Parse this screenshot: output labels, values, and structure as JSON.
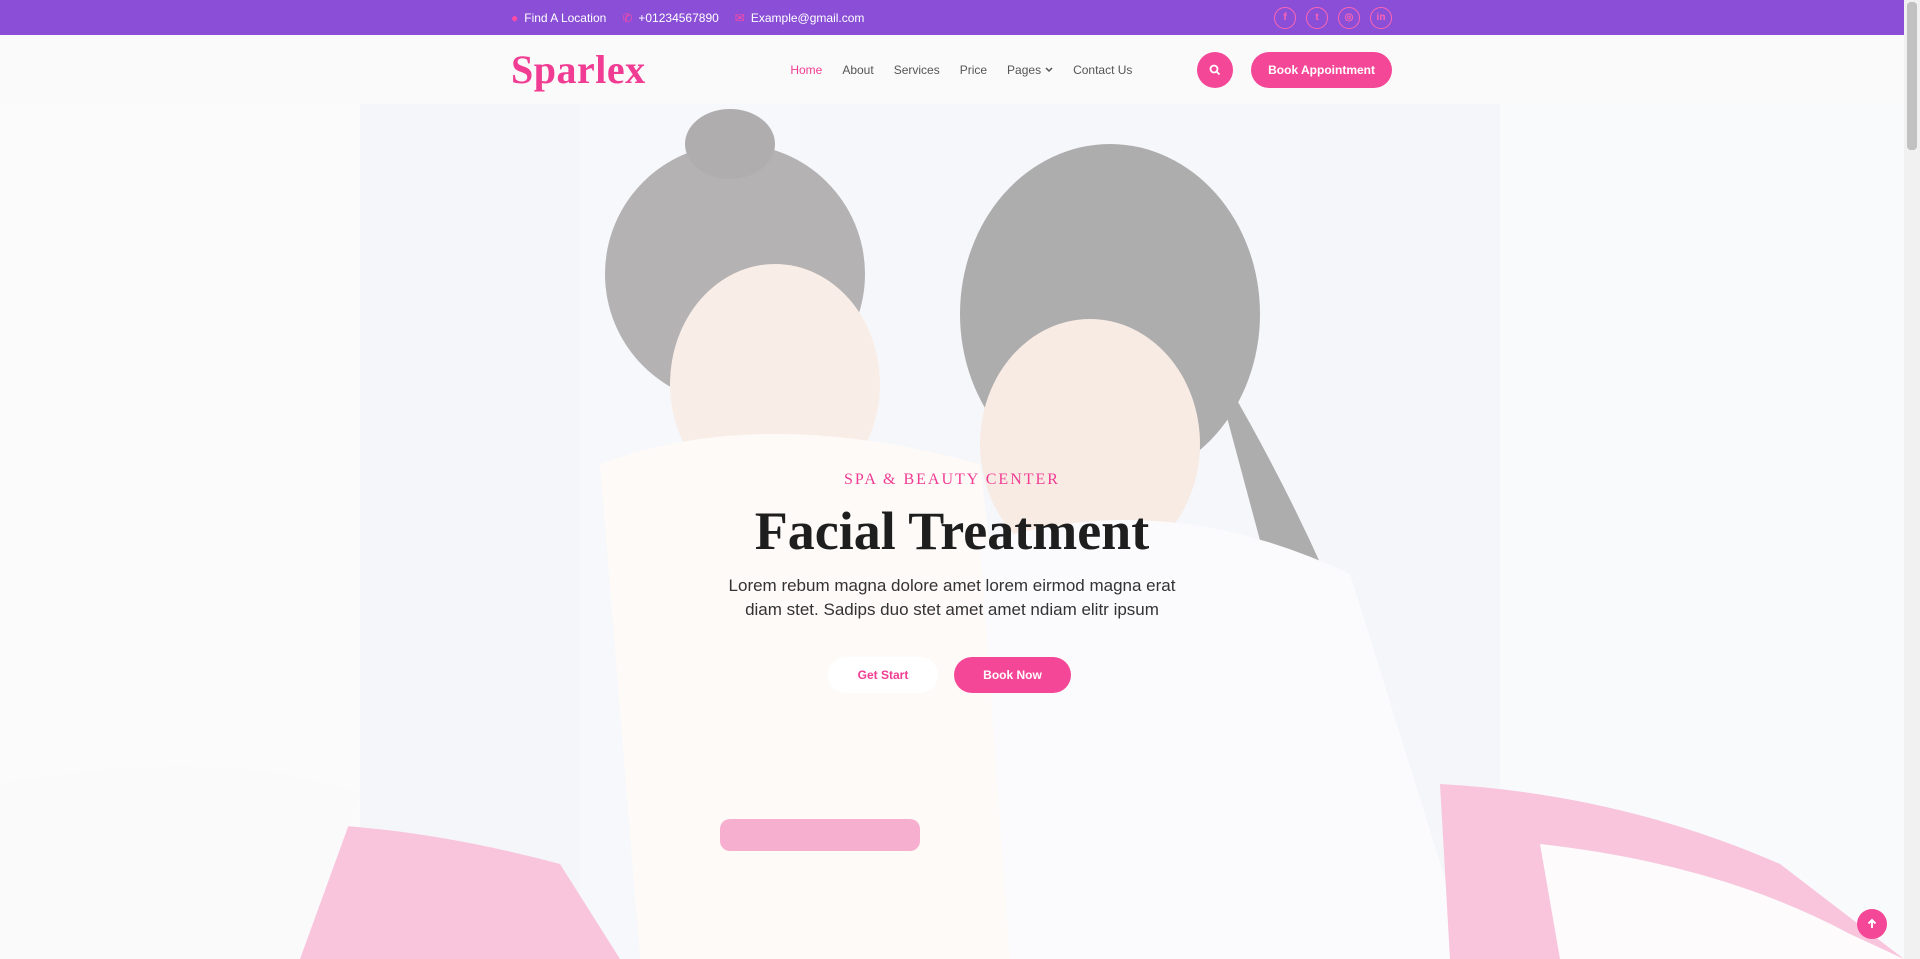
{
  "topbar": {
    "location": "Find A Location",
    "phone": "+01234567890",
    "email": "Example@gmail.com",
    "socials": [
      {
        "icon": "facebook-icon",
        "glyph": "f"
      },
      {
        "icon": "twitter-icon",
        "glyph": "t"
      },
      {
        "icon": "instagram-icon",
        "glyph": "◎"
      },
      {
        "icon": "linkedin-icon",
        "glyph": "in"
      }
    ]
  },
  "nav": {
    "logo": "Sparlex",
    "menu": [
      {
        "label": "Home",
        "active": true
      },
      {
        "label": "About"
      },
      {
        "label": "Services"
      },
      {
        "label": "Price"
      },
      {
        "label": "Pages",
        "dropdown": true
      },
      {
        "label": "Contact Us"
      }
    ],
    "book_label": "Book Appointment"
  },
  "hero": {
    "kicker": "SPA & BEAUTY CENTER",
    "title": "Facial Treatment",
    "subtitle_line1": "Lorem rebum magna dolore amet lorem eirmod magna erat",
    "subtitle_line2": "diam stet. Sadips duo stet amet amet ndiam elitr ipsum",
    "btn_start": "Get Start",
    "btn_book": "Book Now"
  },
  "colors": {
    "topbar": "#8a4fd6",
    "accent": "#f54797",
    "logo": "#f03c93"
  }
}
